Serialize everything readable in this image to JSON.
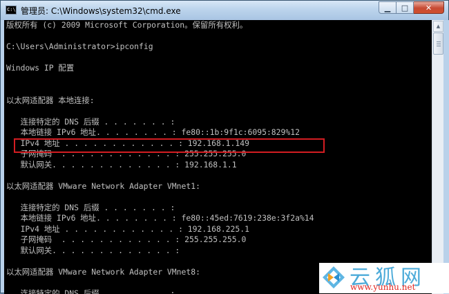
{
  "window": {
    "title": "管理员: C:\\Windows\\system32\\cmd.exe",
    "icon_text": "C:\\",
    "buttons": {
      "minimize": "▁",
      "maximize": "□",
      "close": "✕"
    }
  },
  "console": {
    "lines": [
      "版权所有 (c) 2009 Microsoft Corporation。保留所有权利。",
      "",
      "C:\\Users\\Administrator>ipconfig",
      "",
      "Windows IP 配置",
      "",
      "",
      "以太网适配器 本地连接:",
      "",
      "   连接特定的 DNS 后缀 . . . . . . . :",
      "   本地链接 IPv6 地址. . . . . . . . : fe80::1b:9f1c:6095:829%12",
      "   IPv4 地址 . . . . . . . . . . . . : 192.168.1.149",
      "   子网掩码  . . . . . . . . . . . . : 255.255.255.0",
      "   默认网关. . . . . . . . . . . . . : 192.168.1.1",
      "",
      "以太网适配器 VMware Network Adapter VMnet1:",
      "",
      "   连接特定的 DNS 后缀 . . . . . . . :",
      "   本地链接 IPv6 地址. . . . . . . . : fe80::45ed:7619:238e:3f2a%14",
      "   IPv4 地址 . . . . . . . . . . . . : 192.168.225.1",
      "   子网掩码  . . . . . . . . . . . . : 255.255.255.0",
      "   默认网关. . . . . . . . . . . . . :",
      "",
      "以太网适配器 VMware Network Adapter VMnet8:",
      "",
      "   连接特定的 DNS 后缀 . . . . . . . :"
    ]
  },
  "watermark": {
    "text": "云狐网",
    "url": "www.yunhu.net"
  },
  "colors": {
    "console_bg": "#000000",
    "console_fg": "#c0c0c0",
    "highlight": "#d41d22"
  }
}
